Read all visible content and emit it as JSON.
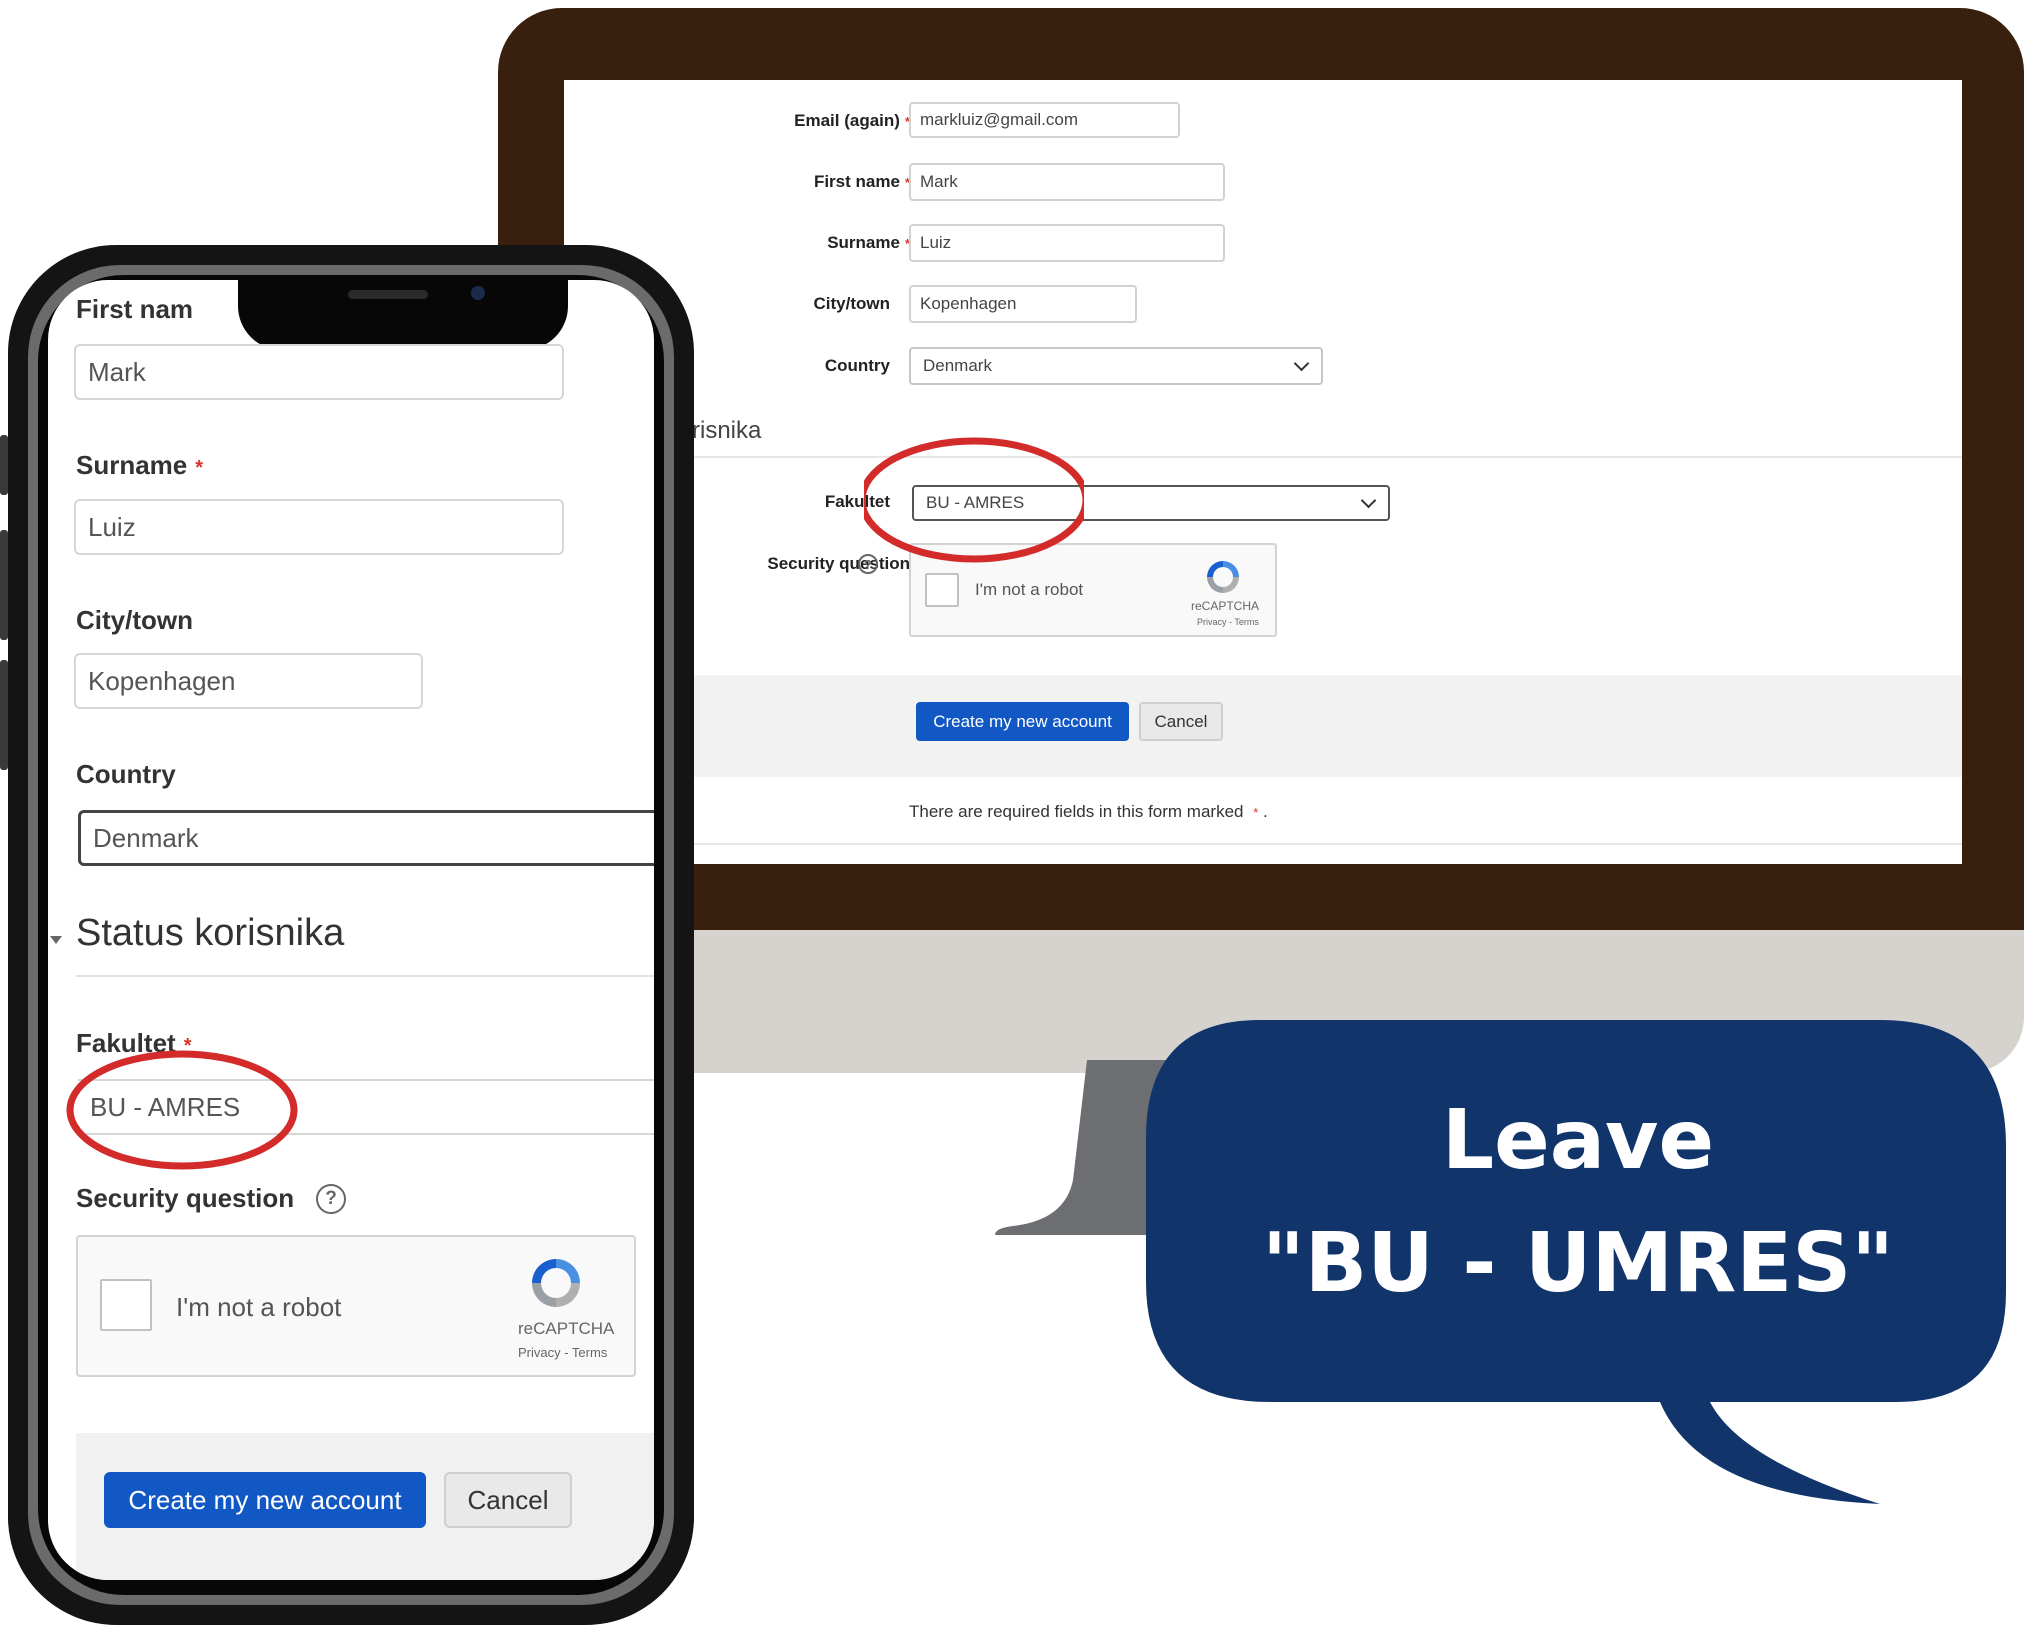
{
  "desktop": {
    "email_again": {
      "label": "Email (again)",
      "value": "markluiz@gmail.com"
    },
    "first_name": {
      "label": "First name",
      "value": "Mark"
    },
    "surname": {
      "label": "Surname",
      "value": "Luiz"
    },
    "city": {
      "label": "City/town",
      "value": "Kopenhagen"
    },
    "country": {
      "label": "Country",
      "value": "Denmark"
    },
    "section_title": "risnika",
    "fakultet": {
      "label": "Fakultet",
      "value": "BU - AMRES"
    },
    "security_question_label": "Security question",
    "recaptcha": {
      "checkbox_label": "I'm not a robot",
      "brand": "reCAPTCHA",
      "links": "Privacy - Terms"
    },
    "buttons": {
      "create": "Create my new account",
      "cancel": "Cancel"
    },
    "required_note": "There are required fields in this form marked",
    "required_marker": "*",
    "required_note_end": "."
  },
  "mobile": {
    "first_name_label": "First nam",
    "first_name_value": "Mark",
    "surname": {
      "label": "Surname",
      "value": "Luiz"
    },
    "city": {
      "label": "City/town",
      "value": "Kopenhagen"
    },
    "country": {
      "label": "Country",
      "value": "Denmark"
    },
    "section_title": "Status korisnika",
    "fakultet": {
      "label": "Fakultet",
      "value": "BU - AMRES"
    },
    "security_question_label": "Security question",
    "recaptcha": {
      "checkbox_label": "I'm not a robot",
      "brand": "reCAPTCHA",
      "links": "Privacy - Terms"
    },
    "buttons": {
      "create": "Create my new account",
      "cancel": "Cancel"
    }
  },
  "required_marker": "*",
  "help_glyph": "?",
  "callout": {
    "line1": "Leave",
    "line2": "\"BU - UMRES\""
  },
  "colors": {
    "monitor_frame": "#39200e",
    "monitor_chin": "#d6d3cf",
    "primary_button": "#1258c4",
    "highlight_circle": "#d32a2a",
    "callout_bg": "#11346b",
    "required": "#d9342b"
  },
  "icons": [
    "recaptcha-logo-icon",
    "help-circle-icon",
    "chevron-down-icon",
    "collapse-triangle-icon"
  ]
}
